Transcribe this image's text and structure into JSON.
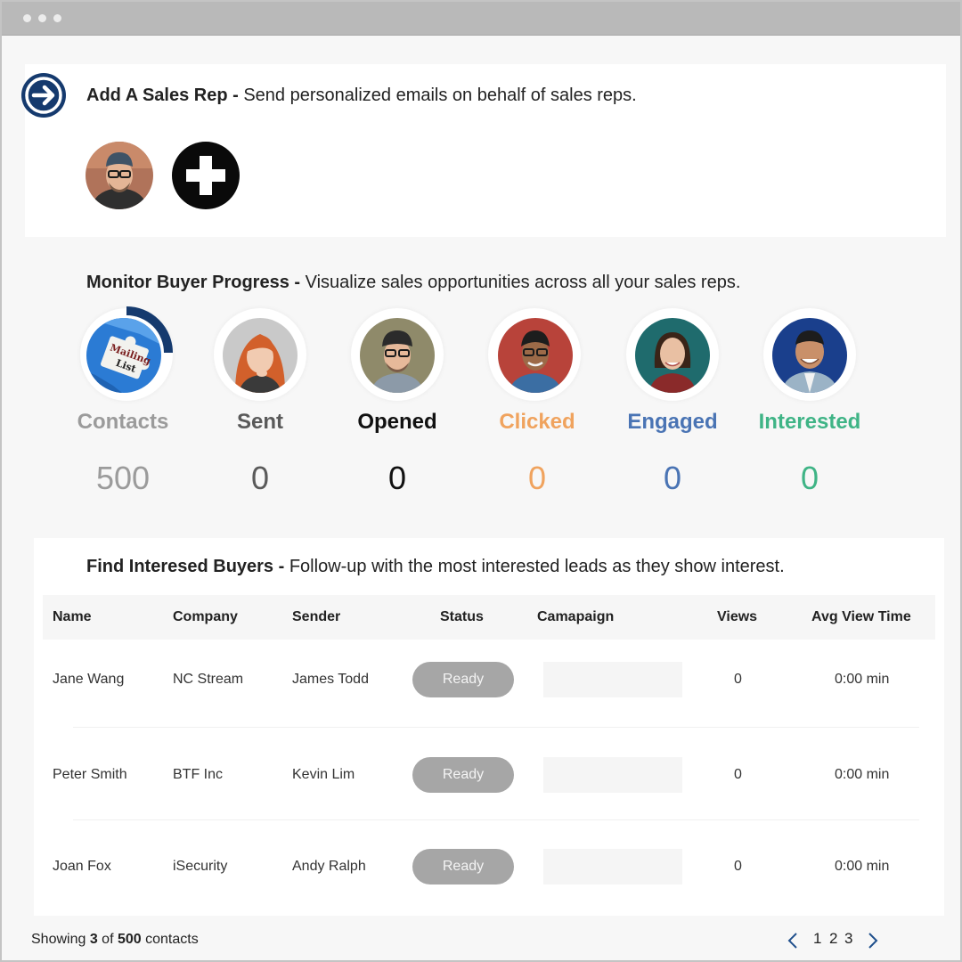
{
  "add_rep": {
    "title": "Add A Sales Rep",
    "separator": " - ",
    "subtitle": "Send personalized emails on behalf of sales reps."
  },
  "monitor": {
    "title": "Monitor Buyer Progress",
    "separator": "  - ",
    "subtitle": "Visualize sales opportunities across all your sales reps.",
    "mailing_list_line1": "Mailing",
    "mailing_list_line2": "List",
    "contacts_progress": 0.25,
    "stats": [
      {
        "label": "Contacts",
        "value": "500",
        "label_color": "#9b9b9b",
        "value_color": "#9b9b9b"
      },
      {
        "label": "Sent",
        "value": "0",
        "label_color": "#5a5a5a",
        "value_color": "#5a5a5a"
      },
      {
        "label": "Opened",
        "value": "0",
        "label_color": "#111111",
        "value_color": "#111111"
      },
      {
        "label": "Clicked",
        "value": "0",
        "label_color": "#f0a35e",
        "value_color": "#f0a35e"
      },
      {
        "label": "Engaged",
        "value": "0",
        "label_color": "#4a74b4",
        "value_color": "#4a74b4"
      },
      {
        "label": "Interested",
        "value": "0",
        "label_color": "#3fb486",
        "value_color": "#3fb486"
      }
    ]
  },
  "buyers": {
    "title": "Find Interesed Buyers",
    "separator": "  - ",
    "subtitle": "Follow-up with the most interested leads as they show interest.",
    "columns": [
      "Name",
      "Company",
      "Sender",
      "Status",
      "Camapaign",
      "Views",
      "Avg View Time"
    ],
    "rows": [
      {
        "name": "Jane Wang",
        "company": "NC Stream",
        "sender": "James Todd",
        "status": "Ready",
        "views": "0",
        "avg": "0:00 min"
      },
      {
        "name": "Peter Smith",
        "company": "BTF Inc",
        "sender": "Kevin Lim",
        "status": "Ready",
        "views": "0",
        "avg": "0:00 min"
      },
      {
        "name": "Joan Fox",
        "company": "iSecurity",
        "sender": "Andy Ralph",
        "status": "Ready",
        "views": "0",
        "avg": "0:00 min"
      }
    ]
  },
  "footer": {
    "showing": "Showing ",
    "shown_count": "3",
    "of": " of ",
    "total": "500",
    "suffix": " contacts"
  },
  "pagination": {
    "pages": [
      "1",
      "2",
      "3"
    ]
  },
  "colors": {
    "brand_navy": "#153a6e",
    "status_pill": "#a6a6a6"
  }
}
